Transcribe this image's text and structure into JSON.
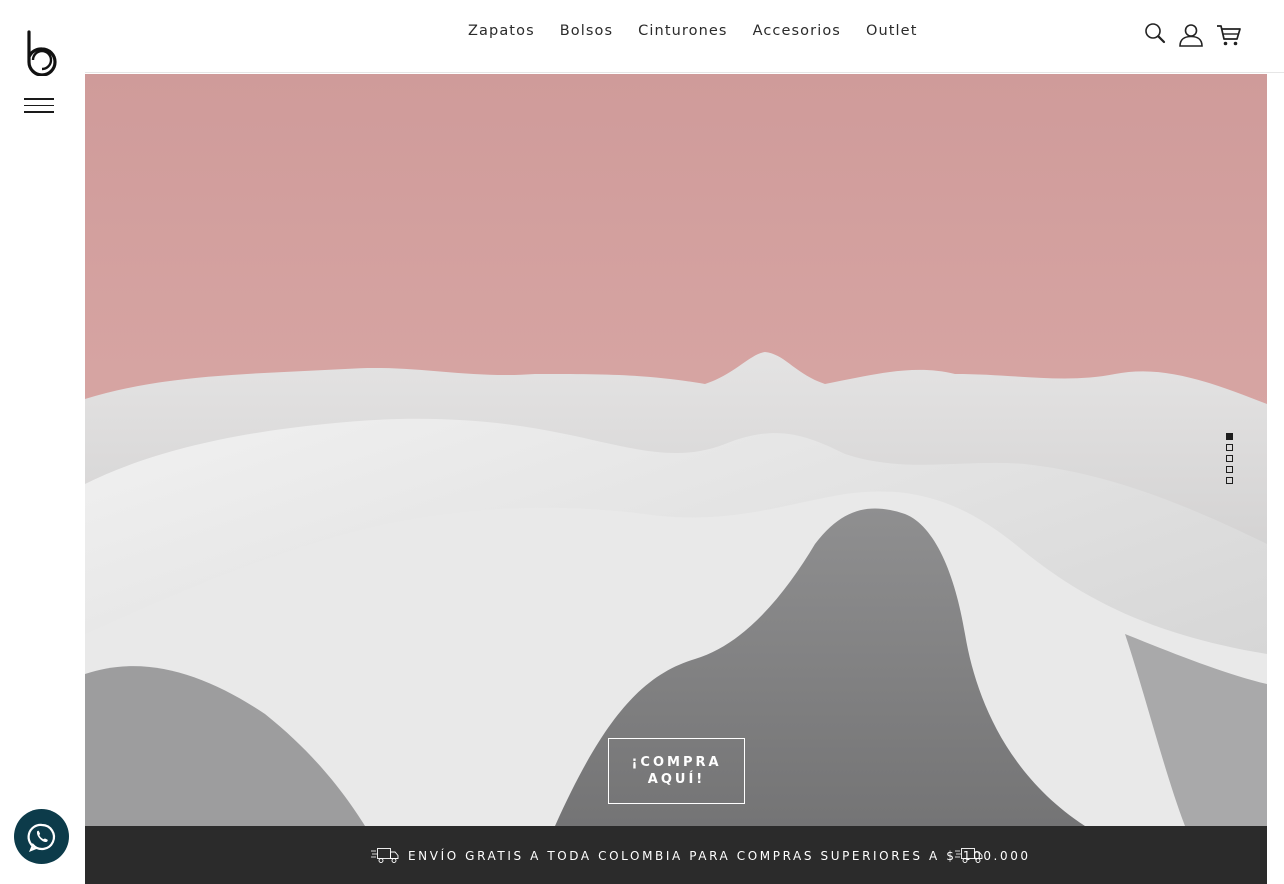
{
  "brand": {
    "logo_icon": "b-logo-icon"
  },
  "nav": {
    "items": [
      {
        "label": "Zapatos"
      },
      {
        "label": "Bolsos"
      },
      {
        "label": "Cinturones"
      },
      {
        "label": "Accesorios"
      },
      {
        "label": "Outlet"
      }
    ]
  },
  "header_icons": [
    "search-icon",
    "user-icon",
    "cart-icon"
  ],
  "hero": {
    "cta_label": "¡COMPRA AQUÍ!",
    "slides": {
      "count": 5,
      "active": 1
    },
    "colors": {
      "sky": "#d7a5a3",
      "fabric": "#c8c8c8"
    }
  },
  "banner": {
    "text": "ENVÍO GRATIS A TODA COLOMBIA PARA COMPRAS SUPERIORES A $ 100.000",
    "icon": "delivery-truck-icon"
  },
  "whatsapp": {
    "icon": "whatsapp-icon",
    "color": "#0c3b4a"
  }
}
